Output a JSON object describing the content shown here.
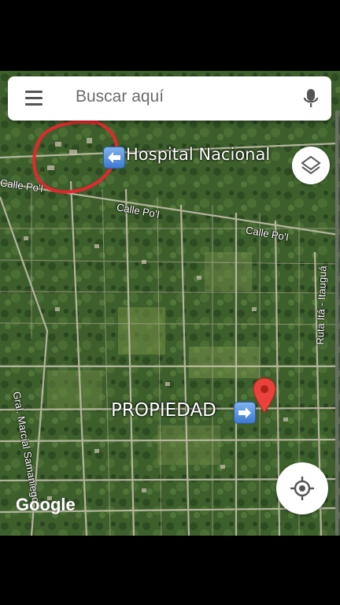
{
  "search": {
    "placeholder": "Buscar aquí",
    "menu_icon": "menu-icon",
    "mic_icon": "mic-icon"
  },
  "annotations": {
    "hospital": "Hospital Nacional",
    "property": "PROPIEDAD",
    "left_arrow_icon": "left-arrow-emoji",
    "right_arrow_icon": "right-arrow-emoji",
    "circle_color": "#e5262f"
  },
  "roads": {
    "calle_poi_left": "Calle Po'I",
    "calle_poi_mid": "Calle Po'I",
    "calle_poi_right": "Calle Po'I",
    "ruta": "Ruta Itá - Itauguá",
    "gral": "Gral. Marcial Samaniego"
  },
  "controls": {
    "layers_icon": "layers-icon",
    "locate_icon": "my-location-icon"
  },
  "branding": {
    "google": "Google"
  },
  "colors": {
    "pin": "#e8423a",
    "road": "#c9c2b0",
    "vegetation": "#3b5f2b"
  }
}
